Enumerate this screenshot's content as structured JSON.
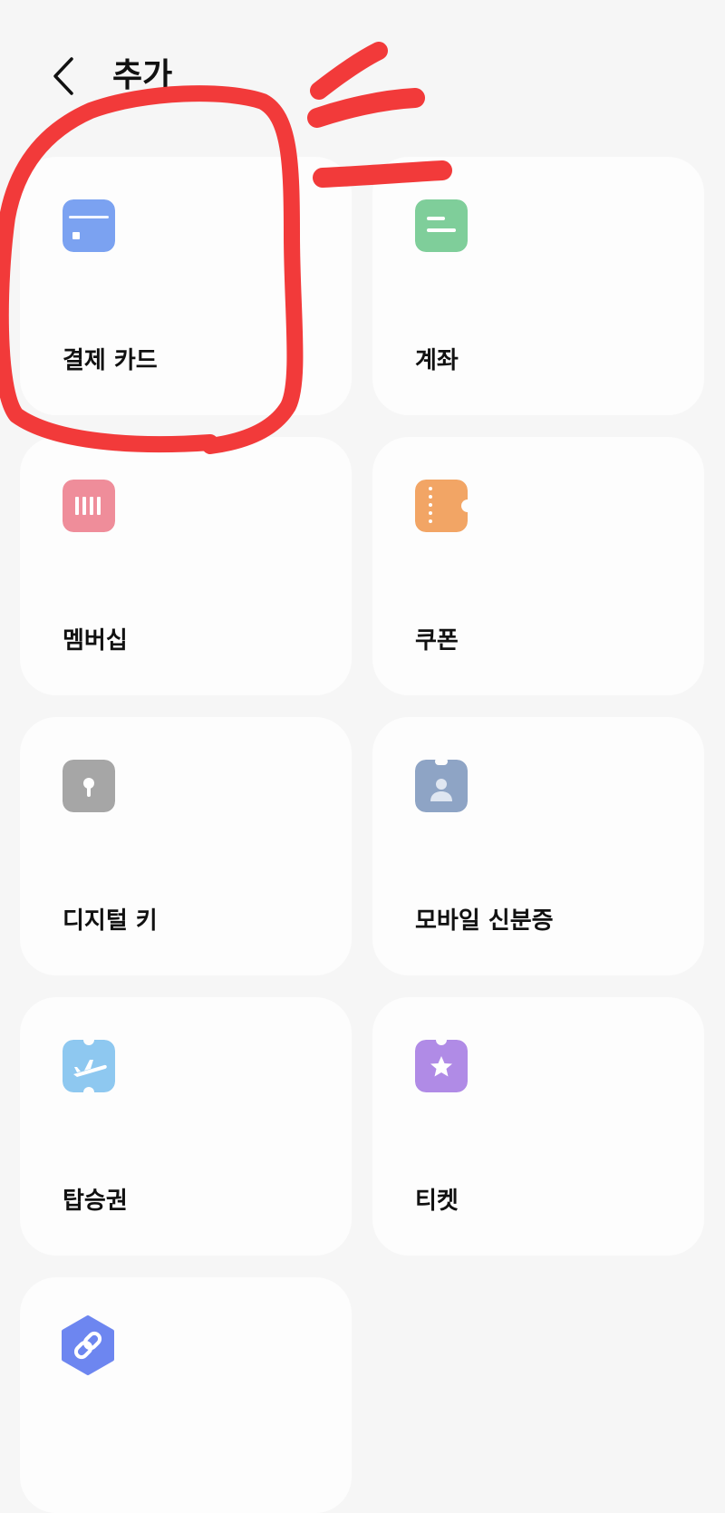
{
  "header": {
    "title": "추가",
    "back_icon": "chevron-left-icon"
  },
  "cards": [
    {
      "label": "결제 카드",
      "icon": "payment-card-icon",
      "color": "#7ba2f1"
    },
    {
      "label": "계좌",
      "icon": "bank-account-icon",
      "color": "#7fce9a"
    },
    {
      "label": "멤버십",
      "icon": "membership-barcode-icon",
      "color": "#ef8d9a"
    },
    {
      "label": "쿠폰",
      "icon": "coupon-icon",
      "color": "#f2a565"
    },
    {
      "label": "디지털 키",
      "icon": "digital-key-icon",
      "color": "#a6a6a6"
    },
    {
      "label": "모바일 신분증",
      "icon": "id-card-icon",
      "color": "#8ea4c5"
    },
    {
      "label": "탑승권",
      "icon": "boarding-pass-icon",
      "color": "#8ec8f0"
    },
    {
      "label": "티켓",
      "icon": "ticket-icon",
      "color": "#b08be6"
    },
    {
      "label": "",
      "icon": "link-icon",
      "color": "#6d86f0"
    }
  ],
  "annotation": {
    "color": "#f23a3a"
  }
}
